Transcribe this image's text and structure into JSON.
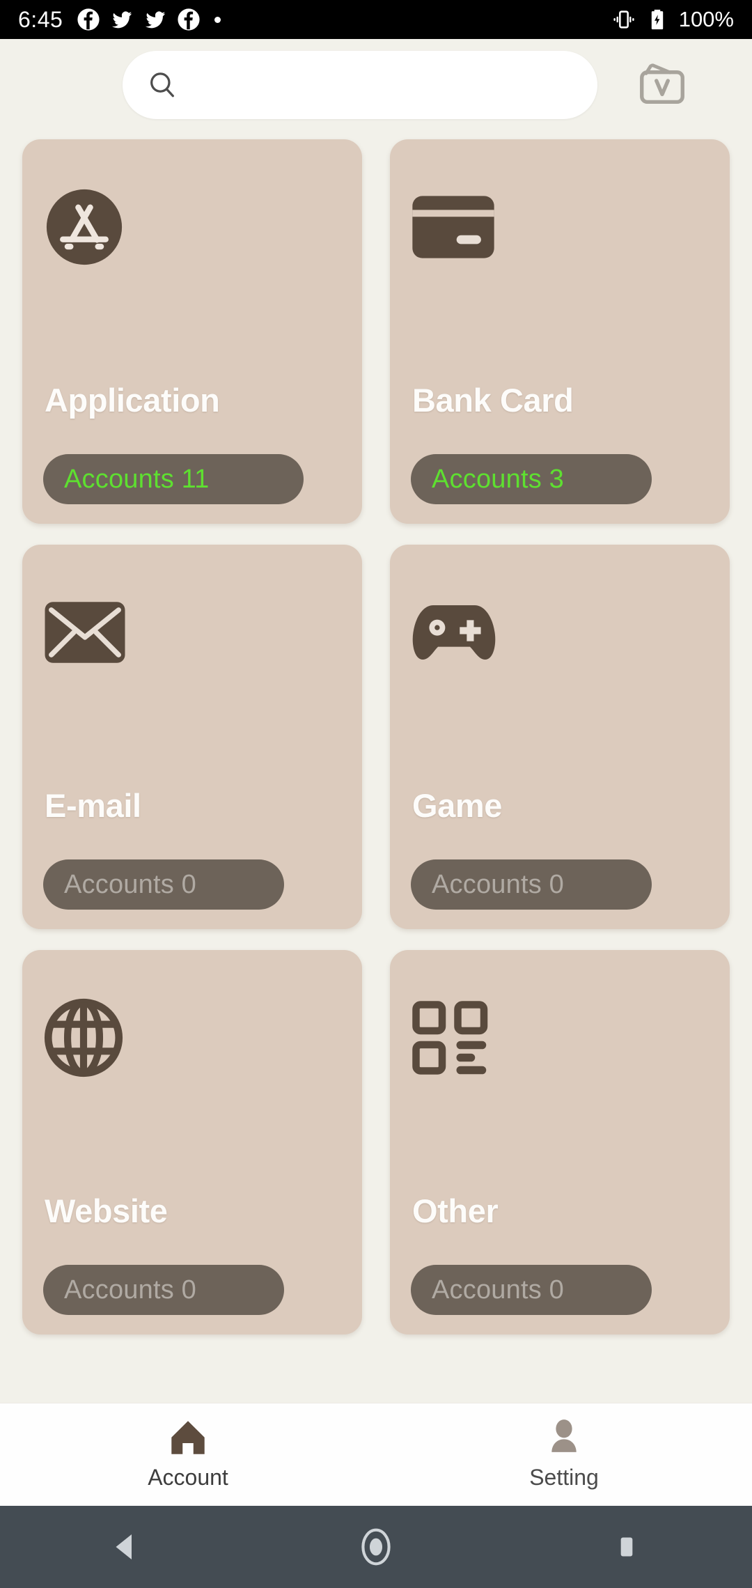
{
  "status_bar": {
    "time": "6:45",
    "left_icons": [
      "facebook-icon",
      "twitter-icon",
      "twitter-icon",
      "facebook-icon",
      "dot-icon"
    ],
    "right_icons": [
      "vibrate-icon",
      "battery-charging-icon"
    ],
    "battery_text": "100%"
  },
  "header": {
    "search_value": "",
    "search_placeholder": "",
    "search_icon": "search-icon",
    "vault_icon": "vault-folder-icon"
  },
  "categories": [
    {
      "icon": "app-store-icon",
      "title": "Application",
      "badge": "Accounts 11",
      "count": 11
    },
    {
      "icon": "credit-card-icon",
      "title": "Bank Card",
      "badge": "Accounts 3",
      "count": 3
    },
    {
      "icon": "envelope-icon",
      "title": "E-mail",
      "badge": "Accounts 0",
      "count": 0
    },
    {
      "icon": "gamepad-icon",
      "title": "Game",
      "badge": "Accounts 0",
      "count": 0
    },
    {
      "icon": "globe-icon",
      "title": "Website",
      "badge": "Accounts 0",
      "count": 0
    },
    {
      "icon": "qr-grid-icon",
      "title": "Other",
      "badge": "Accounts 0",
      "count": 0
    }
  ],
  "tab_bar": {
    "tabs": [
      {
        "icon": "home-icon",
        "label": "Account",
        "active": true
      },
      {
        "icon": "person-icon",
        "label": "Setting",
        "active": false
      }
    ]
  },
  "nav_bar": {
    "buttons": [
      "back-icon",
      "home-circle-icon",
      "recents-square-icon"
    ]
  },
  "colors": {
    "page_background": "#f2f1ea",
    "card_background": "#dccbbd",
    "icon_brown": "#594a3d",
    "badge_background": "#6d6359",
    "badge_green": "#5ee030",
    "badge_gray": "#b0aaa3",
    "tab_active": "#5d4c3e",
    "tab_inactive": "#9c9188",
    "nav_background": "#444c53"
  }
}
